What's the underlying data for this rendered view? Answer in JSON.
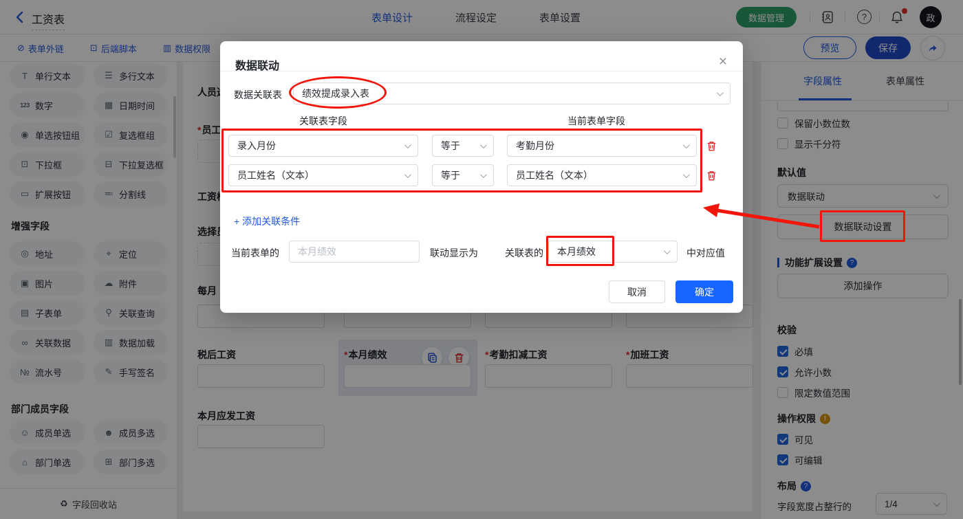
{
  "topbar": {
    "title": "工资表",
    "tabs": [
      {
        "label": "表单设计"
      },
      {
        "label": "流程设定"
      },
      {
        "label": "表单设置"
      }
    ],
    "data_manage": "数据管理",
    "avatar": "政",
    "accent_blue": "#2059de",
    "green": "#2f9e68"
  },
  "toolbar": {
    "links": [
      {
        "icon": "⊘",
        "label": "表单外链"
      },
      {
        "icon": "⊡",
        "label": "后端脚本"
      },
      {
        "icon": "▥",
        "label": "数据权限"
      }
    ],
    "preview": "预览",
    "save": "保存"
  },
  "sidebar": {
    "basic": [
      {
        "icon": "T",
        "label": "单行文本"
      },
      {
        "icon": "☰",
        "label": "多行文本"
      },
      {
        "icon": "123",
        "label": "数字"
      },
      {
        "icon": "▦",
        "label": "日期时间"
      },
      {
        "icon": "◉",
        "label": "单选按钮组"
      },
      {
        "icon": "☑",
        "label": "复选框组"
      },
      {
        "icon": "⊡",
        "label": "下拉框"
      },
      {
        "icon": "⊟",
        "label": "下拉复选框"
      },
      {
        "icon": "▭",
        "label": "扩展按钮"
      },
      {
        "icon": "≕",
        "label": "分割线"
      }
    ],
    "enhanced_title": "增强字段",
    "enhanced": [
      {
        "icon": "◎",
        "label": "地址"
      },
      {
        "icon": "⌖",
        "label": "定位"
      },
      {
        "icon": "▣",
        "label": "图片"
      },
      {
        "icon": "☁",
        "label": "附件"
      },
      {
        "icon": "▤",
        "label": "子表单"
      },
      {
        "icon": "⚲",
        "label": "关联查询"
      },
      {
        "icon": "∞",
        "label": "关联数据"
      },
      {
        "icon": "▥",
        "label": "数据加载"
      },
      {
        "icon": "№",
        "label": "流水号"
      },
      {
        "icon": "✎",
        "label": "手写签名"
      }
    ],
    "dept_title": "部门成员字段",
    "dept": [
      {
        "icon": "☺",
        "label": "成员单选"
      },
      {
        "icon": "☻",
        "label": "成员多选"
      },
      {
        "icon": "⌂",
        "label": "部门单选"
      },
      {
        "icon": "⊞",
        "label": "部门多选"
      }
    ],
    "recycle": {
      "icon": "♻",
      "label": "字段回收站"
    }
  },
  "canvas": {
    "partial_labels": [
      {
        "text": "人员选"
      },
      {
        "text": "员工姓",
        "required": "*"
      },
      {
        "text": "工资档"
      },
      {
        "text": "选择员"
      },
      {
        "text": "每月"
      }
    ],
    "row_fields": [
      {
        "label": "税后工资"
      },
      {
        "label": "本月绩效",
        "required": "*",
        "selected": true
      },
      {
        "label": "考勤扣减工资",
        "required": "*"
      },
      {
        "label": "加班工资",
        "required": "*"
      }
    ],
    "bottom_field": {
      "label": "本月应发工资"
    }
  },
  "modal": {
    "title": "数据联动",
    "close": "×",
    "link_table_label": "数据关联表",
    "link_table_value": "绩效提成录入表",
    "col_left": "关联表字段",
    "col_right": "当前表单字段",
    "conditions": [
      {
        "left": "录入月份",
        "op": "等于",
        "right": "考勤月份"
      },
      {
        "left": "员工姓名（文本）",
        "op": "等于",
        "right": "员工姓名（文本）"
      }
    ],
    "add_condition": "+ 添加关联条件",
    "current_form_label": "当前表单的",
    "current_field_value": "本月绩效",
    "display_as": "联动显示为",
    "linked_form_label": "关联表的",
    "linked_field_value": "本月绩效",
    "suffix": "中对应值",
    "cancel": "取消",
    "ok": "确定",
    "primary": "#1766ff"
  },
  "right_sidebar": {
    "tabs": [
      {
        "label": "字段属性",
        "active": true
      },
      {
        "label": "表单属性"
      }
    ],
    "top_checkboxes": [
      {
        "label": "保留小数位数",
        "checked": false
      },
      {
        "label": "显示千分符",
        "checked": false
      }
    ],
    "default_value": {
      "title": "默认值",
      "select_value": "数据联动",
      "button": "数据联动设置"
    },
    "extension": {
      "title": "功能扩展设置",
      "button": "添加操作"
    },
    "validation": {
      "title": "校验",
      "items": [
        {
          "label": "必填",
          "checked": true
        },
        {
          "label": "允许小数",
          "checked": true
        },
        {
          "label": "限定数值范围",
          "checked": false
        }
      ]
    },
    "permission": {
      "title": "操作权限",
      "items": [
        {
          "label": "可见",
          "checked": true
        },
        {
          "label": "可编辑",
          "checked": true
        }
      ]
    },
    "layout": {
      "title": "布局",
      "label": "字段宽度占整行的",
      "value": "1/4"
    }
  },
  "annotation_color": "#f2150a"
}
